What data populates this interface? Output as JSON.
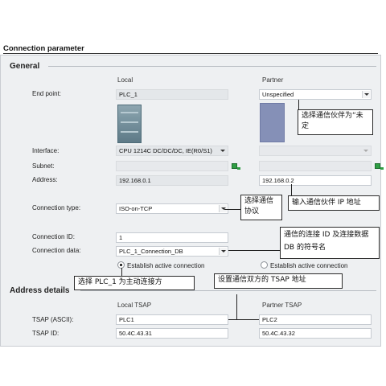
{
  "header": {
    "title": "Connection parameter"
  },
  "general": {
    "section_title": "General",
    "col_local": "Local",
    "col_partner": "Partner",
    "end_point": {
      "label": "End point:",
      "local": "PLC_1",
      "partner": "Unspecified"
    },
    "interface": {
      "label": "Interface:",
      "local": "CPU 1214C DC/DC/DC, IE(R0/S1)",
      "partner": ""
    },
    "subnet": {
      "label": "Subnet:",
      "local": "",
      "partner": ""
    },
    "address": {
      "label": "Address:",
      "local": "192.168.0.1",
      "partner": "192.168.0.2"
    },
    "connection_type": {
      "label": "Connection type:",
      "value": "ISO-on-TCP"
    },
    "connection_id": {
      "label": "Connection ID:",
      "value": "1"
    },
    "connection_data": {
      "label": "Connection data:",
      "value": "PLC_1_Connection_DB"
    },
    "establish_local": {
      "label": "Establish active connection",
      "selected": true
    },
    "establish_partner": {
      "label": "Establish active connection",
      "selected": false
    }
  },
  "address_details": {
    "section_title": "Address details",
    "col_local": "Local TSAP",
    "col_partner": "Partner TSAP",
    "tsap_ascii": {
      "label": "TSAP (ASCII):",
      "local": "PLC1",
      "partner": "PLC2"
    },
    "tsap_id": {
      "label": "TSAP ID:",
      "local": "50.4C.43.31",
      "partner": "50.4C.43.32"
    }
  },
  "annotations": {
    "partner_unspecified": "选择通信伙伴为“未定",
    "partner_ip": "输入通信伙伴 IP 地址",
    "select_protocol": "选择通信协议",
    "connection_id_db": "通信的连接 ID 及连接数据 DB 的符号名",
    "active_connection": "选择 PLC_1 为主动连接方",
    "tsap_address": "设置通信双方的 TSAP 地址"
  },
  "colors": {
    "panel_bg": "#eef0f2",
    "field_border": "#c6cbd1",
    "status_green": "#2f9e44"
  }
}
